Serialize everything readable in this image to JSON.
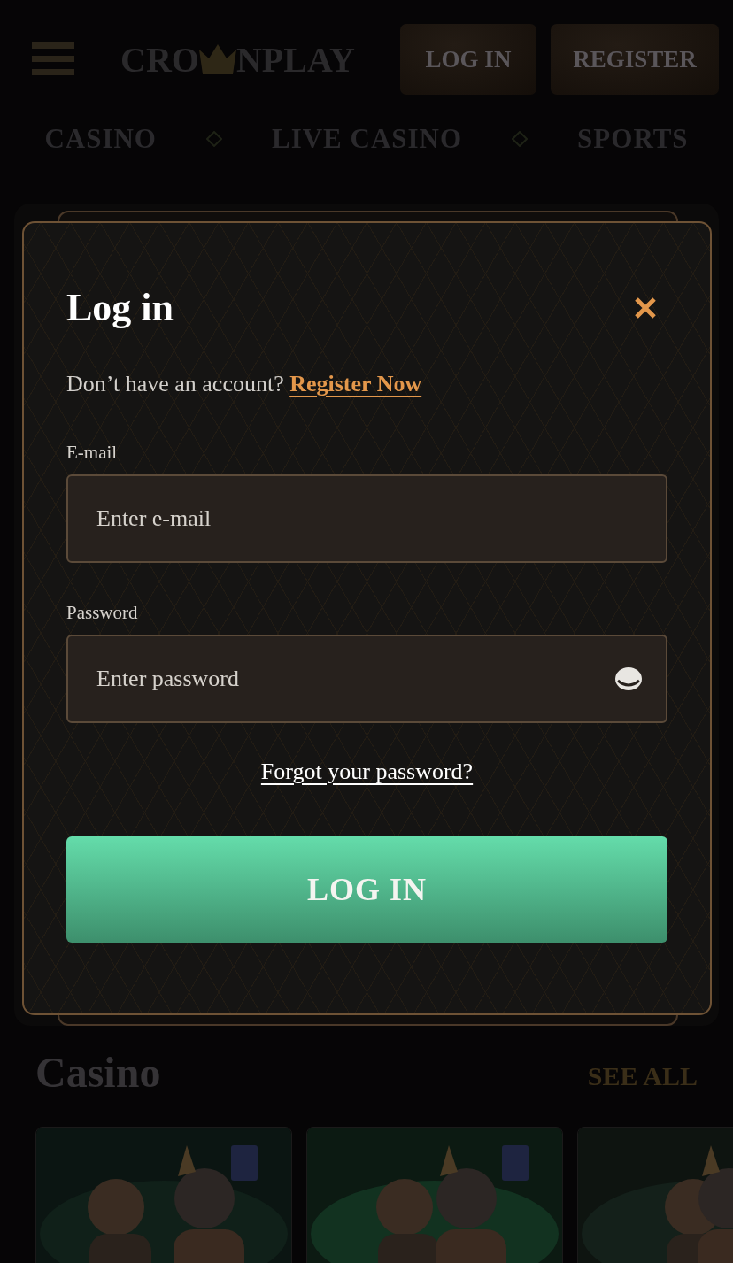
{
  "header": {
    "logo_left": "CRO",
    "logo_right": "NPLAY",
    "buttons": [
      {
        "label": "LOG IN",
        "kind": "login"
      },
      {
        "label": "REGISTER",
        "kind": "register"
      }
    ]
  },
  "nav": {
    "items": [
      {
        "label": "CASINO"
      },
      {
        "label": "LIVE CASINO"
      },
      {
        "label": "SPORTS"
      }
    ]
  },
  "modal": {
    "title": "Log in",
    "prompt": "Don’t have an account?",
    "register_link": "Register Now",
    "fields": [
      {
        "label": "E-mail",
        "placeholder": "Enter e-mail",
        "kind": "email"
      },
      {
        "label": "Password",
        "placeholder": "Enter password",
        "kind": "password"
      }
    ],
    "forgot_link": "Forgot your password?",
    "submit": "LOG IN"
  },
  "section": {
    "title": "Casino",
    "see_all": "SEE ALL"
  }
}
